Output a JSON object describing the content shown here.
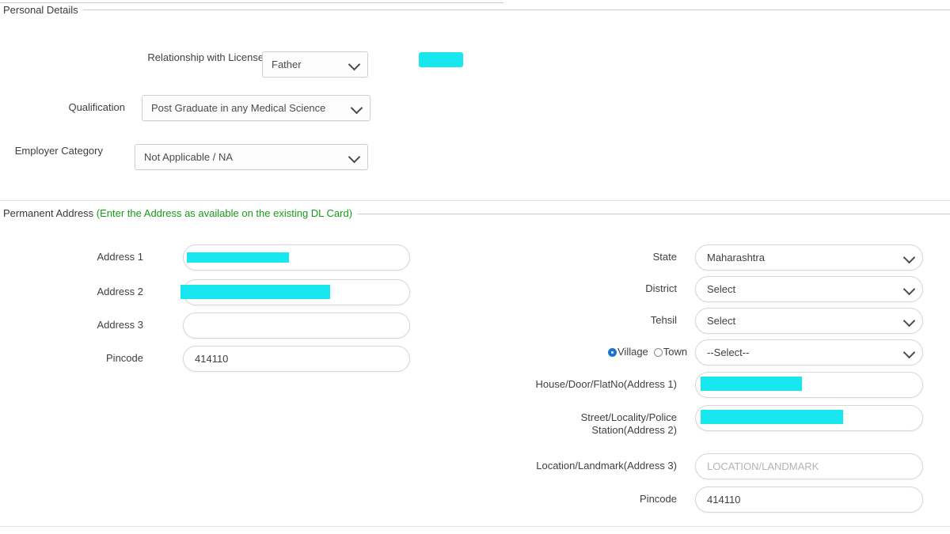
{
  "personal_details": {
    "legend": "Personal Details",
    "fields": [
      {
        "label": "Relationship with License Holder",
        "value": "Father"
      },
      {
        "label": "Qualification",
        "value": "Post Graduate in any Medical Science"
      },
      {
        "label": "Employer Category",
        "value": "Not Applicable / NA"
      }
    ]
  },
  "permanent_address": {
    "legend_main": "Permanent Address ",
    "legend_hint": "(Enter the Address as available on the existing DL Card)",
    "left_fields": [
      {
        "label": "Address 1",
        "value": ""
      },
      {
        "label": "Address 2",
        "value": ""
      },
      {
        "label": "Address 3",
        "value": ""
      },
      {
        "label": "Pincode",
        "value": "414110"
      }
    ],
    "right_fields": [
      {
        "label": "State",
        "value": "Maharashtra"
      },
      {
        "label": "District",
        "value": "Select"
      },
      {
        "label": "Tehsil",
        "value": "Select"
      },
      {
        "label": "Village/Town",
        "value": "--Select--"
      },
      {
        "label": "House/Door/FlatNo(Address 1)",
        "value": ""
      },
      {
        "label": "Street/Locality/Police Station(Address 2)",
        "value": ""
      },
      {
        "label": "Location/Landmark(Address 3)",
        "value": "LOCATION/LANDMARK"
      },
      {
        "label": "Pincode",
        "value": "414110"
      }
    ],
    "street_label_line1": "Street/Locality/Police",
    "street_label_line2": "Station(Address 2)",
    "radio_group": {
      "village_label": "Village",
      "town_label": "Town",
      "selected": "Village"
    }
  },
  "colors": {
    "redaction": "#18e7ef",
    "hint_green": "#169b16",
    "radio_blue": "#1a73d4"
  }
}
